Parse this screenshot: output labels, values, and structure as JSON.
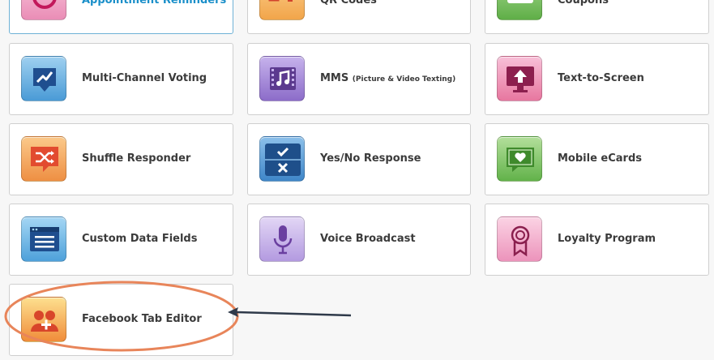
{
  "tiles": {
    "appointment_reminders": {
      "label": "Appointment Reminders",
      "icon": "clock-icon",
      "color": "#f4a6c8"
    },
    "qr_codes": {
      "label": "QR Codes",
      "icon": "qr-code-icon",
      "color": "#f6b35f"
    },
    "coupons": {
      "label": "Coupons",
      "icon": "coupon-icon",
      "color": "#7cc16a"
    },
    "multi_channel_voting": {
      "label": "Multi-Channel Voting",
      "icon": "voting-icon",
      "color": "#5aa9de"
    },
    "mms": {
      "label": "MMS",
      "label_small": "(Picture & Video Texting)",
      "icon": "music-icon",
      "color": "#9b7fd4"
    },
    "text_to_screen": {
      "label": "Text-to-Screen",
      "icon": "screen-upload-icon",
      "color": "#ee8fb8"
    },
    "shuffle_responder": {
      "label": "Shuffle Responder",
      "icon": "shuffle-icon",
      "color": "#f09a4e"
    },
    "yes_no_response": {
      "label": "Yes/No Response",
      "icon": "check-x-icon",
      "color": "#4f94d4"
    },
    "mobile_ecards": {
      "label": "Mobile eCards",
      "icon": "heart-card-icon",
      "color": "#7cc16a"
    },
    "custom_data_fields": {
      "label": "Custom Data Fields",
      "icon": "list-form-icon",
      "color": "#5aa9de"
    },
    "voice_broadcast": {
      "label": "Voice Broadcast",
      "icon": "microphone-icon",
      "color": "#b9a3e0"
    },
    "loyalty_program": {
      "label": "Loyalty Program",
      "icon": "ribbon-award-icon",
      "color": "#f1a7c8"
    },
    "facebook_tab_editor": {
      "label": "Facebook Tab Editor",
      "icon": "users-plus-icon",
      "color": "#f09a4e"
    }
  },
  "annotation": {
    "highlight_color": "#e8855a",
    "arrow_color": "#2f3a4a"
  }
}
